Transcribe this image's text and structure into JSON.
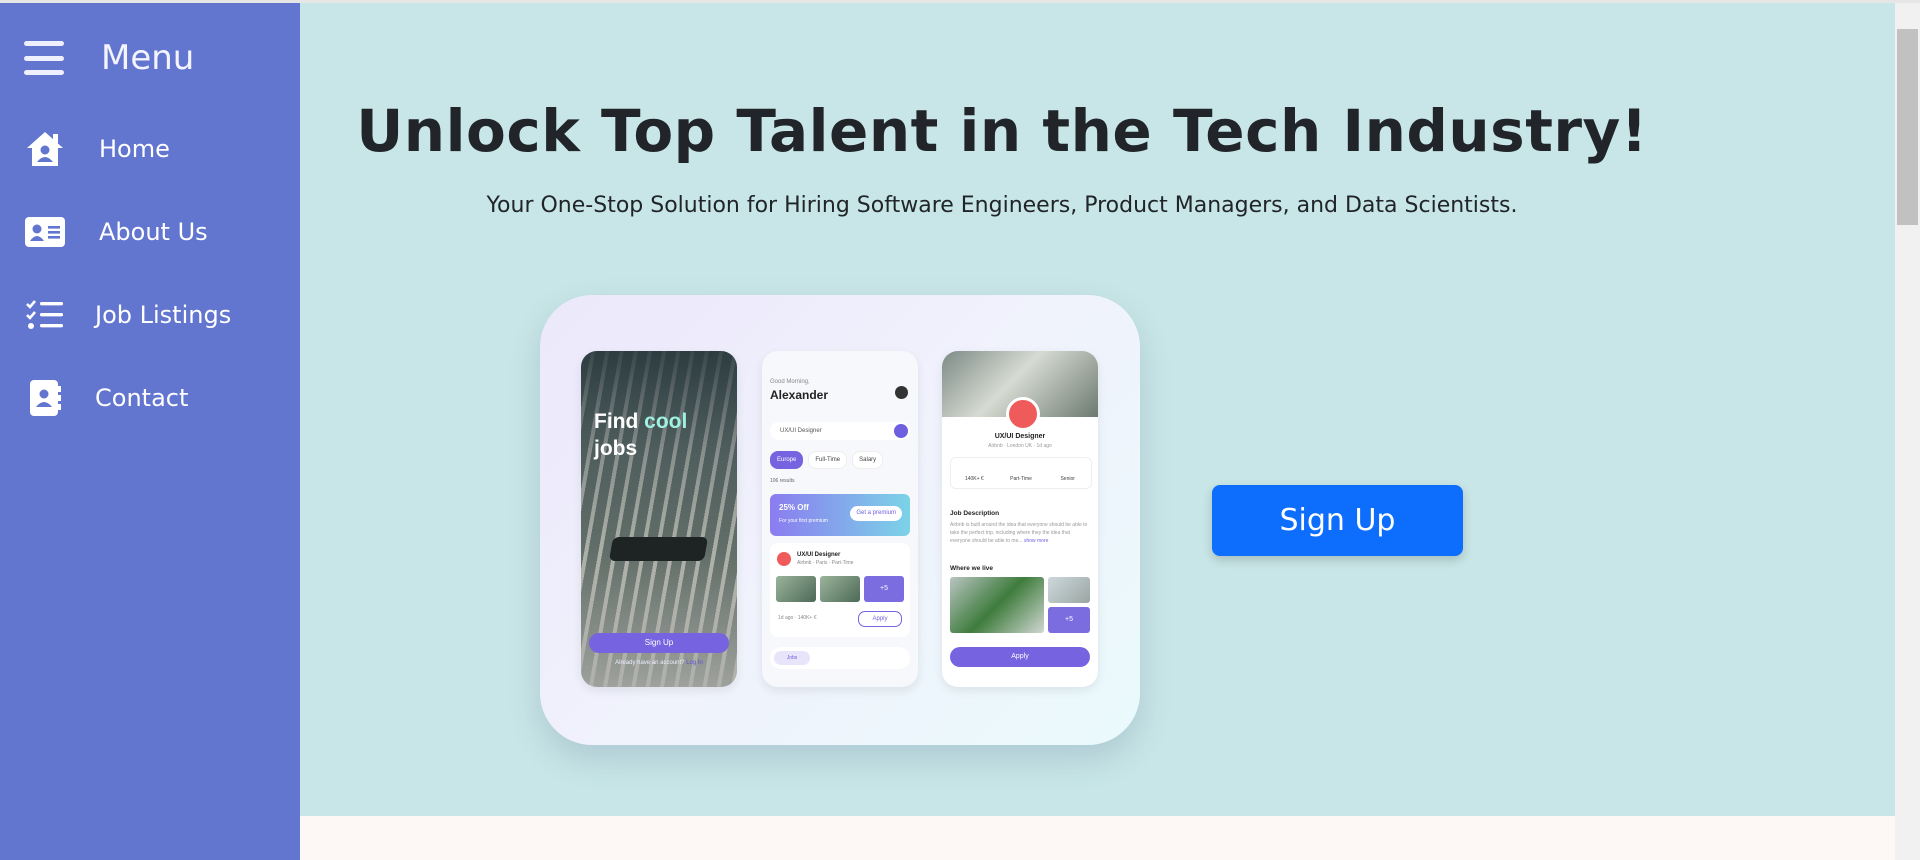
{
  "menu": {
    "title": "Menu",
    "icon": "hamburger-icon"
  },
  "nav": {
    "items": [
      {
        "label": "Home",
        "icon": "house-user-icon"
      },
      {
        "label": "About Us",
        "icon": "address-card-icon"
      },
      {
        "label": "Job Listings",
        "icon": "list-check-icon"
      },
      {
        "label": "Contact",
        "icon": "address-book-icon"
      }
    ]
  },
  "hero": {
    "title": "Unlock Top Talent in the Tech Industry!",
    "subtitle": "Your One-Stop Solution for Hiring Software Engineers, Product Managers, and Data Scientists.",
    "cta": "Sign Up"
  },
  "mockup": {
    "phone1": {
      "line1": "Find ",
      "highlight": "cool",
      "line2": "jobs",
      "button": "Sign Up",
      "account_text": "Already have an account?",
      "login": "Log In"
    },
    "phone2": {
      "greeting": "Good Morning,",
      "name": "Alexander",
      "search": "UX/UI Designer",
      "chips": [
        "Europe",
        "Full-Time",
        "Salary"
      ],
      "results": "106 results",
      "promo_title": "25% Off",
      "promo_sub": "For your first premium",
      "promo_button": "Get a premium",
      "job_title": "UX/UI Designer",
      "job_sub": "Airbnb · Paris · Part-Time",
      "more_photos": "+5",
      "job_meta": "1d ago · 140K+ €",
      "apply": "Apply",
      "tab": "Jobs"
    },
    "phone3": {
      "title": "UX/UI Designer",
      "sub": "Airbnb · London UK · 1d ago",
      "stats": [
        "140K+ €",
        "Part-Time",
        "Senior"
      ],
      "desc_title": "Job Description",
      "desc": "Airbnb is built around the idea that everyone should be able to take the perfect trip, including where they the idea that everyone should be able to me...",
      "show_more": "show more",
      "where": "Where we live",
      "more_photos": "+5",
      "apply": "Apply"
    }
  },
  "colors": {
    "sidebar": "#6275cf",
    "main_bg": "#c8e6e7",
    "primary": "#0d6efd",
    "accent": "#7663e0"
  }
}
